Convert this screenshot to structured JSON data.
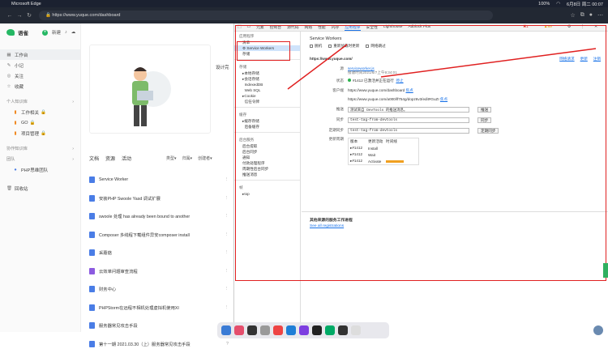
{
  "menubar": {
    "app": "Microsoft Edge",
    "battery": "100%",
    "time": "6月8日 周二 00:07"
  },
  "browser": {
    "url": "https://www.yuque.com/dashboard"
  },
  "app": {
    "logo": "语雀",
    "new_label": "新建",
    "nav": [
      "工作台",
      "小记",
      "关注",
      "收藏"
    ],
    "personal_group": "个人知识库",
    "repos": [
      "工作相关",
      "GO",
      "项目管理"
    ],
    "collab_group": "协作知识库",
    "team_group": "团队",
    "team": "PHP思维团队",
    "trash": "回收站",
    "card_partial": "设计完",
    "tabs": [
      "文档",
      "资源",
      "活动"
    ],
    "filters": [
      "类型",
      "归属",
      "创建者"
    ],
    "docs": [
      "Service Worker",
      "安装PHP Swoole Yasd 调试扩展",
      "swoole 处理 has already been bound to another",
      "Composer 多线程下载组件异安composer install",
      "采蘑菇",
      "云效单问题审查流程",
      "财务中心",
      "PHPStorm在远程不相机处理虚拟机使用XI",
      "服务器常见攻击手段",
      "第十一期 2021.03.30（上）服务器常见攻击手段"
    ]
  },
  "devtools": {
    "tabs": [
      "元素",
      "控制台",
      "源代码",
      "网络",
      "性能",
      "内存",
      "应用程序",
      "安全性",
      "Lighthouse",
      "Adblock Plus"
    ],
    "active_tab": "应用程序",
    "errors": "1",
    "warnings": "89",
    "left": {
      "app_section": "应用程序",
      "app_items": [
        "清单",
        "Service Workers",
        "存储"
      ],
      "storage_section": "存储",
      "storage_items": [
        "本地存储",
        "会话存储",
        "IndexedDB",
        "Web SQL",
        "Cookie",
        "信任令牌"
      ],
      "cache_section": "缓存",
      "cache_items": [
        "缓存存储",
        "后备缓存"
      ],
      "bg_section": "后台服务",
      "bg_items": [
        "后台提取",
        "后台同步",
        "通知",
        "付款处理程序",
        "周期性后台同步",
        "推送消息"
      ],
      "frames_section": "帧",
      "frames_items": [
        "top"
      ]
    },
    "sw": {
      "title": "Service Workers",
      "opt1": "脱机",
      "opt2": "重新加载时更新",
      "opt3": "网络跳过",
      "origin": "https://www.yuque.com/",
      "links": [
        "网络请求",
        "更新",
        "注销"
      ],
      "source_k": "源",
      "source_v": "serviceworker.js",
      "received": "接收时间2021/6/7上午9:34:01",
      "status_k": "状态",
      "status_v": "#1412 已激活并正在运行",
      "stop": "停止",
      "clients_k": "客户端",
      "client1": "https://www.yuque.com/dashboard",
      "client2": "https://www.yuque.com/a000/lf754g/dopz6v3/edit#GuZI",
      "focus": "焦点",
      "push_k": "推送",
      "push_v": "测试来自 DevTools 的推送消息。",
      "push_btn": "推送",
      "sync_k": "同步",
      "sync_v": "test-tag-from-devtools",
      "sync_btn": "同步",
      "psync_k": "定期同步",
      "psync_v": "test-tag-from-devtools",
      "psync_btn": "定期同步",
      "cycle_k": "更新周期",
      "cycle_head": [
        "版本",
        "更新活动",
        "时间线"
      ],
      "cycle_rows": [
        [
          "#1412",
          "Install"
        ],
        [
          "#1412",
          "Wait"
        ],
        [
          "#1412",
          "Activate"
        ]
      ],
      "footer_title": "其他来源的服务工作进程",
      "footer_link": "See all registrations"
    }
  }
}
